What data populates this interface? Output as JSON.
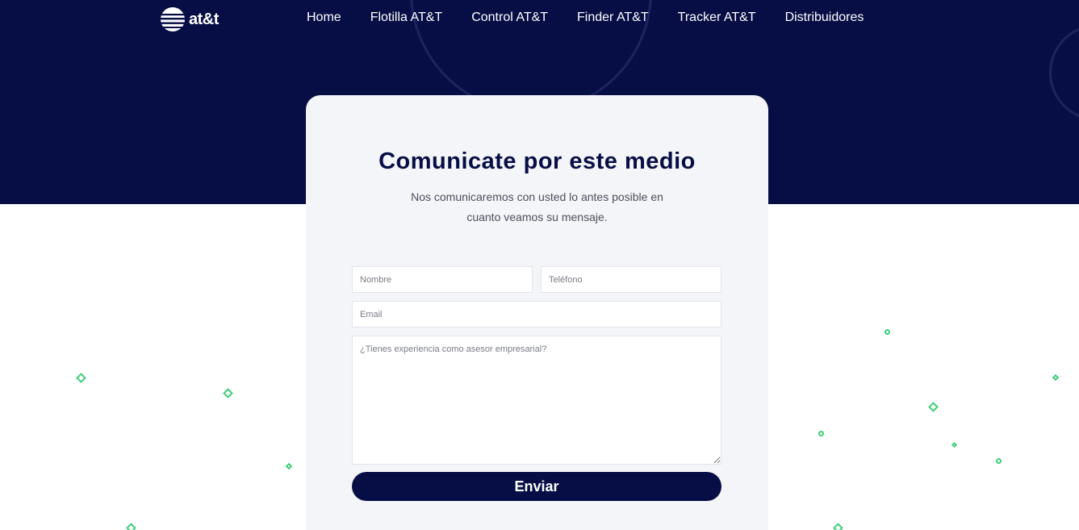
{
  "brand": {
    "logo_text": "at&t"
  },
  "nav": {
    "items": [
      "Home",
      "Flotilla AT&T",
      "Control AT&T",
      "Finder AT&T",
      "Tracker AT&T",
      "Distribuidores"
    ]
  },
  "contact": {
    "title": "Comunicate por este medio",
    "subtitle_line1": "Nos comunicaremos con usted lo antes posible en",
    "subtitle_line2": "cuanto veamos su mensaje.",
    "fields": {
      "name_placeholder": "Nombre",
      "phone_placeholder": "Teléfono",
      "email_placeholder": "Email",
      "message_placeholder": "¿Tienes experiencia como asesor empresarial?"
    },
    "submit_label": "Enviar"
  },
  "colors": {
    "primary_navy": "#070e45",
    "card_bg": "#f4f5f9",
    "accent_green": "#3ecf7a"
  }
}
